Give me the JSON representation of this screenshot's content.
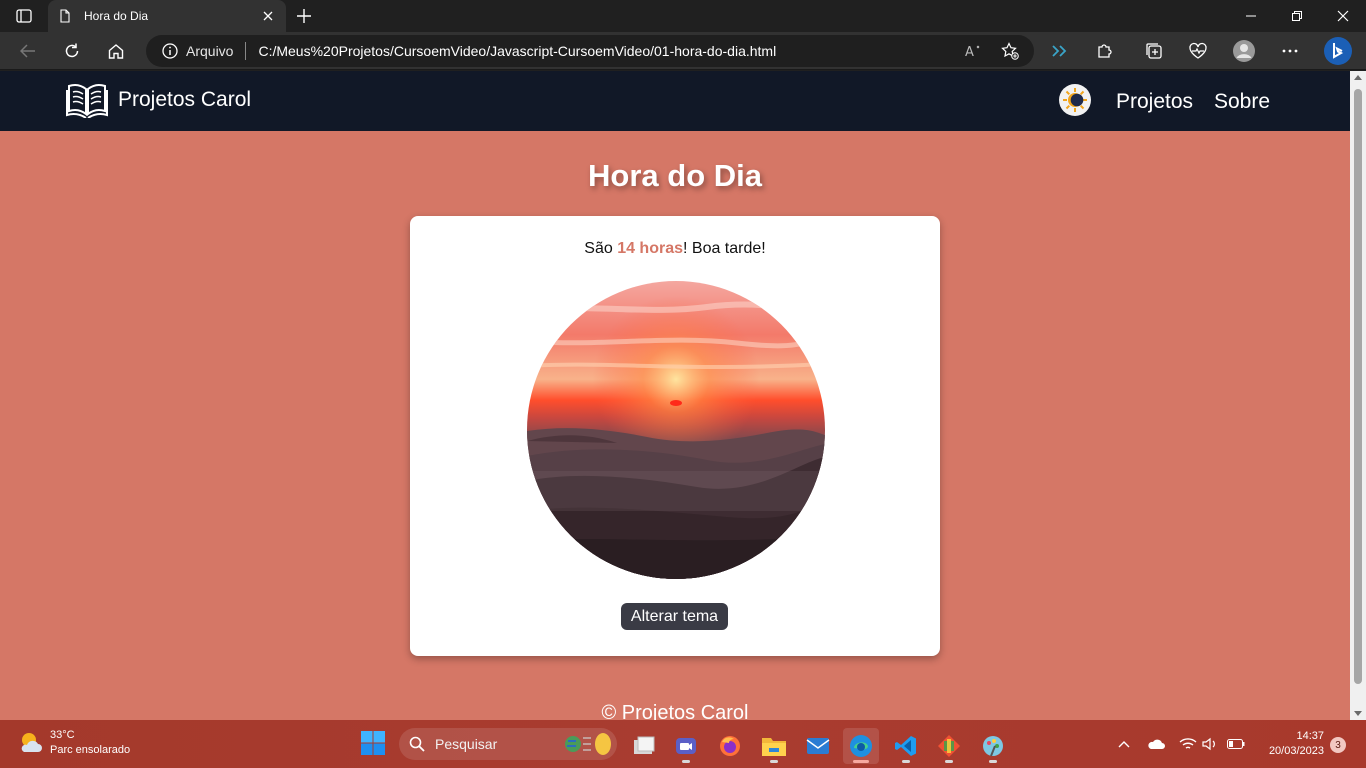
{
  "browser": {
    "tab_title": "Hora do Dia",
    "address_scheme": "Arquivo",
    "url": "C:/Meus%20Projetos/CursoemVideo/Javascript-CursoemVideo/01-hora-do-dia.html"
  },
  "site": {
    "brand": "Projetos Carol",
    "nav": [
      "Projetos",
      "Sobre"
    ],
    "page_title": "Hora do Dia",
    "message_prefix": "São ",
    "message_hour": "14 horas",
    "message_suffix": "! Boa tarde!",
    "theme_button": "Alterar tema",
    "footer": "© Projetos Carol",
    "colors": {
      "background": "#d57766",
      "header": "#111827",
      "button": "#3a3b45",
      "accent": "#d57766"
    },
    "image_semantic": "sunset-over-misty-hills"
  },
  "taskbar": {
    "weather_temp": "33°C",
    "weather_desc": "Parc ensolarado",
    "search_placeholder": "Pesquisar",
    "time": "14:37",
    "date": "20/03/2023",
    "notifications": "3",
    "apps": [
      "file-explorer-icon",
      "task-view-icon",
      "meet-icon",
      "firefox-icon",
      "folder-icon",
      "mail-icon",
      "edge-icon",
      "vscode-icon",
      "git-icon",
      "paint-icon"
    ]
  }
}
